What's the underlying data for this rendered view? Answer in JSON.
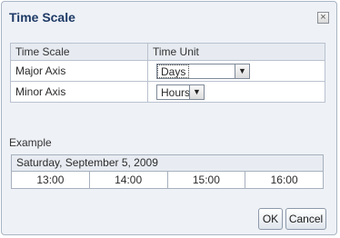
{
  "dialog": {
    "title": "Time Scale",
    "close_icon": "close-icon"
  },
  "table": {
    "headers": [
      "Time Scale",
      "Time Unit"
    ],
    "rows": [
      {
        "label": "Major Axis",
        "value": "Days"
      },
      {
        "label": "Minor Axis",
        "value": "Hours"
      }
    ]
  },
  "example": {
    "label": "Example",
    "date": "Saturday, September 5, 2009",
    "times": [
      "13:00",
      "14:00",
      "15:00",
      "16:00"
    ]
  },
  "buttons": {
    "ok": "OK",
    "cancel": "Cancel"
  }
}
